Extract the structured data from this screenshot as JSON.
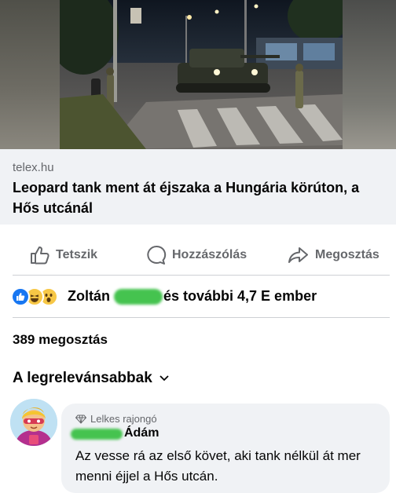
{
  "link_preview": {
    "domain": "telex.hu",
    "headline": "Leopard tank ment át éjszaka a Hungária körúton, a Hős utcánál"
  },
  "actions": {
    "like_label": "Tetszik",
    "comment_label": "Hozzászólás",
    "share_label": "Megosztás"
  },
  "reactions": {
    "icons": [
      "like-icon",
      "haha-icon",
      "wow-icon"
    ],
    "name": "Zoltán",
    "rest": "és további 4,7 E ember"
  },
  "shares": {
    "label": "389 megosztás"
  },
  "sort": {
    "label": "A legrelevánsabbak"
  },
  "comment": {
    "badge": "Lelkes rajongó",
    "author": "Ádám",
    "text": "Az vesse rá az első követ, aki tank nélkül át mer menni éjjel a Hős utcán."
  },
  "colors": {
    "link_bg": "#f0f2f5",
    "secondary_text": "#65676b",
    "like_blue": "#1877f2",
    "censor_green": "#45c34f"
  }
}
